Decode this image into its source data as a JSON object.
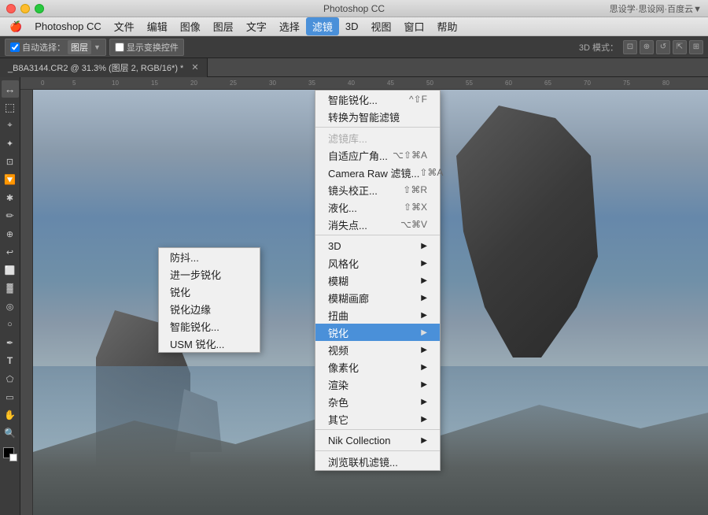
{
  "titleBar": {
    "appName": "Photoshop CC",
    "windowTitle": "思设学·思设网·百度云",
    "rightInfo": "思设学·思设网·百度云▼"
  },
  "menuBar": {
    "appIcon": "🍎",
    "items": [
      {
        "label": "Photoshop CC",
        "id": "ps"
      },
      {
        "label": "文件",
        "id": "file"
      },
      {
        "label": "编辑",
        "id": "edit"
      },
      {
        "label": "图像",
        "id": "image"
      },
      {
        "label": "图层",
        "id": "layer"
      },
      {
        "label": "文字",
        "id": "type"
      },
      {
        "label": "选择",
        "id": "select"
      },
      {
        "label": "滤镜",
        "id": "filter",
        "active": true
      },
      {
        "label": "3D",
        "id": "3d"
      },
      {
        "label": "视图",
        "id": "view"
      },
      {
        "label": "窗口",
        "id": "window"
      },
      {
        "label": "帮助",
        "id": "help"
      }
    ]
  },
  "toolbar": {
    "autoSelect": "自动选择：",
    "layerLabel": "图层",
    "showTransform": "显示变换控件",
    "modeLabel": "3D 模式："
  },
  "tabBar": {
    "tab": "_B8A3144.CR2 @ 31.3% (图层 2, RGB/16*) *"
  },
  "filterMenu": {
    "items": [
      {
        "label": "智能锐化...",
        "shortcut": "^⇧F",
        "section": 1,
        "id": "smart-sharpen-top"
      },
      {
        "label": "转换为智能滤镜",
        "section": 1,
        "id": "convert-smart"
      },
      {
        "label": "滤镜库...",
        "section": 2,
        "id": "filter-gallery",
        "disabled": true
      },
      {
        "label": "自适应广角...",
        "shortcut": "⌥⇧⌘A",
        "section": 2,
        "id": "adaptive-wide"
      },
      {
        "label": "Camera Raw 滤镜...",
        "shortcut": "⇧⌘A",
        "section": 2,
        "id": "camera-raw"
      },
      {
        "label": "镜头校正...",
        "shortcut": "⇧⌘R",
        "section": 2,
        "id": "lens-correct"
      },
      {
        "label": "液化...",
        "shortcut": "⇧⌘X",
        "section": 2,
        "id": "liquify"
      },
      {
        "label": "消失点...",
        "shortcut": "⌥⌘V",
        "section": 2,
        "id": "vanishing-point"
      },
      {
        "label": "3D",
        "hasArrow": true,
        "section": 3,
        "id": "3d-menu"
      },
      {
        "label": "风格化",
        "hasArrow": true,
        "section": 3,
        "id": "stylize"
      },
      {
        "label": "模糊",
        "hasArrow": true,
        "section": 3,
        "id": "blur"
      },
      {
        "label": "模糊画廊",
        "hasArrow": true,
        "section": 3,
        "id": "blur-gallery"
      },
      {
        "label": "扭曲",
        "hasArrow": true,
        "section": 3,
        "id": "distort"
      },
      {
        "label": "锐化",
        "hasArrow": true,
        "section": 3,
        "id": "sharpen",
        "highlighted": true
      },
      {
        "label": "视频",
        "hasArrow": true,
        "section": 3,
        "id": "video"
      },
      {
        "label": "像素化",
        "hasArrow": true,
        "section": 3,
        "id": "pixelate"
      },
      {
        "label": "渲染",
        "hasArrow": true,
        "section": 3,
        "id": "render"
      },
      {
        "label": "杂色",
        "hasArrow": true,
        "section": 3,
        "id": "noise"
      },
      {
        "label": "其它",
        "hasArrow": true,
        "section": 3,
        "id": "other"
      },
      {
        "label": "Nik Collection",
        "hasArrow": true,
        "section": 4,
        "id": "nik"
      },
      {
        "label": "浏览联机滤镜...",
        "section": 5,
        "id": "browse-online"
      }
    ]
  },
  "sharpenSubmenu": {
    "items": [
      {
        "label": "防抖...",
        "id": "reduce-shake"
      },
      {
        "label": "进一步锐化",
        "id": "sharpen-more"
      },
      {
        "label": "锐化",
        "id": "sharpen"
      },
      {
        "label": "锐化边缘",
        "id": "sharpen-edges"
      },
      {
        "label": "智能锐化...",
        "id": "smart-sharpen"
      },
      {
        "label": "USM 锐化...",
        "id": "usm-sharpen"
      }
    ]
  },
  "leftTools": [
    {
      "icon": "↔",
      "name": "move"
    },
    {
      "icon": "⬚",
      "name": "marquee"
    },
    {
      "icon": "⌖",
      "name": "lasso"
    },
    {
      "icon": "✦",
      "name": "magic-wand"
    },
    {
      "icon": "✂",
      "name": "crop"
    },
    {
      "icon": "⊙",
      "name": "eyedropper"
    },
    {
      "icon": "✒",
      "name": "spot-heal"
    },
    {
      "icon": "✏",
      "name": "brush"
    },
    {
      "icon": "◫",
      "name": "clone-stamp"
    },
    {
      "icon": "☁",
      "name": "history-brush"
    },
    {
      "icon": "⬛",
      "name": "eraser"
    },
    {
      "icon": "▓",
      "name": "gradient"
    },
    {
      "icon": "◎",
      "name": "blur-tool"
    },
    {
      "icon": "☼",
      "name": "dodge"
    },
    {
      "icon": "✒",
      "name": "pen"
    },
    {
      "icon": "T",
      "name": "type"
    },
    {
      "icon": "⬠",
      "name": "path-select"
    },
    {
      "icon": "▭",
      "name": "shape"
    },
    {
      "icon": "✋",
      "name": "hand"
    },
    {
      "icon": "🔍",
      "name": "zoom"
    }
  ],
  "colors": {
    "menuHighlight": "#4a90d9",
    "menuBg": "#f0f0f0",
    "toolbarBg": "#3c3c3c",
    "menuBorder": "#aaa"
  }
}
